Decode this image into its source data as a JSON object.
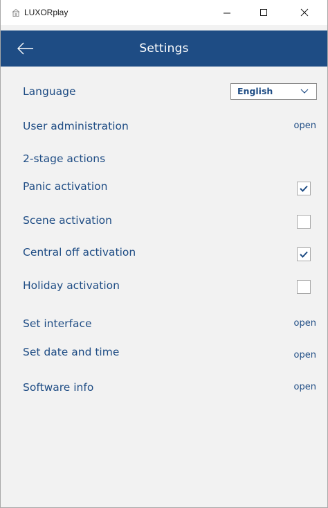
{
  "window": {
    "title": "LUXORplay",
    "icons": {
      "app": "house-icon",
      "minimize": "minimize-icon",
      "maximize": "maximize-icon",
      "close": "close-icon"
    }
  },
  "header": {
    "title": "Settings",
    "back_icon": "arrow-left-icon",
    "color": "#1e4c84"
  },
  "settings": {
    "language": {
      "label": "Language",
      "selected": "English"
    },
    "user_admin": {
      "label": "User administration",
      "action": "open"
    },
    "two_stage_heading": "2-stage actions",
    "panic": {
      "label": "Panic activation",
      "checked": true
    },
    "scene": {
      "label": "Scene activation",
      "checked": false
    },
    "central_off": {
      "label": "Central off activation",
      "checked": true
    },
    "holiday": {
      "label": "Holiday activation",
      "checked": false
    },
    "set_interface": {
      "label": "Set interface",
      "action": "open"
    },
    "date_time": {
      "label": "Set date and time",
      "action": "open"
    },
    "software_info": {
      "label": "Software info",
      "action": "open"
    }
  },
  "colors": {
    "accent": "#1e4c84",
    "background": "#f2f2f2"
  }
}
